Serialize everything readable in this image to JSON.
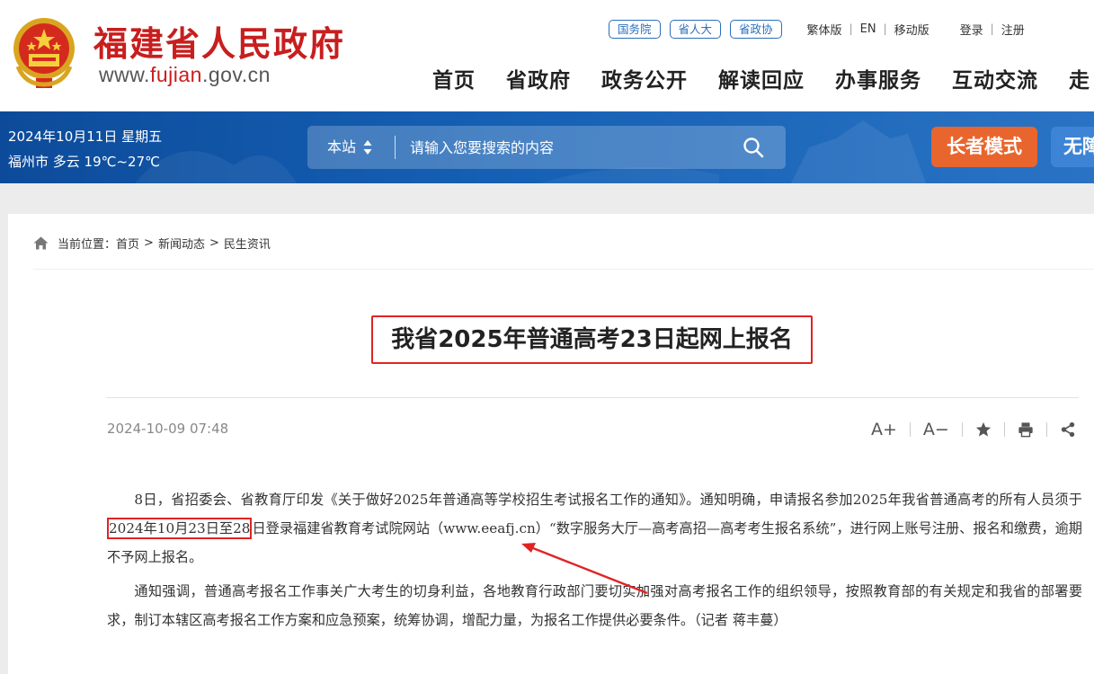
{
  "header": {
    "site_name": "福建省人民政府",
    "url_prefix": "www.",
    "url_highlight": "fujian",
    "url_suffix": ".gov.cn",
    "top_pills": [
      "国务院",
      "省人大",
      "省政协"
    ],
    "lang_links": [
      "繁体版",
      "EN",
      "移动版"
    ],
    "auth_links": [
      "登录",
      "注册"
    ],
    "nav": [
      "首页",
      "省政府",
      "政务公开",
      "解读回应",
      "办事服务",
      "互动交流",
      "走"
    ]
  },
  "banner": {
    "date": "2024年10月11日 星期五",
    "weather": "福州市 多云 19℃~27℃",
    "search_scope": "本站",
    "search_placeholder": "请输入您要搜索的内容",
    "elder_mode": "长者模式",
    "accessibility": "无障碍"
  },
  "breadcrumb": {
    "prefix": "当前位置：",
    "items": [
      "首页",
      "新闻动态",
      "民生资讯"
    ]
  },
  "article": {
    "title": "我省2025年普通高考23日起网上报名",
    "date": "2024-10-09 07:48",
    "tools": {
      "font_up": "A+",
      "font_down": "A−"
    },
    "p1_a": "8日，省招委会、省教育厅印发《关于做好2025年普通高等学校招生考试报名工作的通知》。通知明确，申请报名参加2025年我省普通高考的所有人员须于",
    "p1_highlight": "2024年10月23日至28",
    "p1_b": "日登录福建省教育考试院网站（www.eeafj.cn）“数字服务大厅—高考高招—高考考生报名系统”，进行网上账号注册、报名和缴费，逾期不予网上报名。",
    "p2": "通知强调，普通高考报名工作事关广大考生的切身利益，各地教育行政部门要切实加强对高考报名工作的组织领导，按照教育部的有关规定和我省的部署要求，制订本辖区高考报名工作方案和应急预案，统筹协调，增配力量，为报名工作提供必要条件。（记者  蒋丰蔓）"
  },
  "colors": {
    "brand_red": "#c81e1e",
    "banner_blue": "#1560b4",
    "elder_orange": "#e8652d",
    "annotation_red": "#e02424",
    "pill_blue": "#2a6fbc"
  },
  "icons": [
    "national-emblem-icon",
    "sort-arrows-icon",
    "search-icon",
    "home-icon",
    "star-icon",
    "print-icon",
    "share-icon"
  ]
}
